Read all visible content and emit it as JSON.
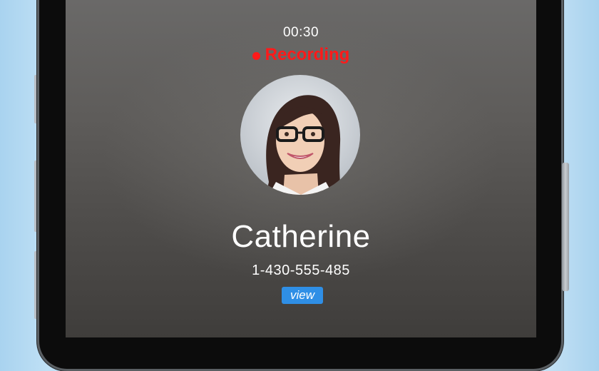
{
  "call": {
    "timer": "00:30",
    "recording_label": "Recording",
    "contact_name": "Catherine",
    "phone_number": "1-430-555-485",
    "view_label": "view"
  },
  "colors": {
    "recording": "#ff1a1a",
    "view_button": "#2f8fe6",
    "background": "#cfe7f7"
  },
  "icons": {
    "avatar": "contact-photo",
    "recording_indicator": "red-dot"
  }
}
